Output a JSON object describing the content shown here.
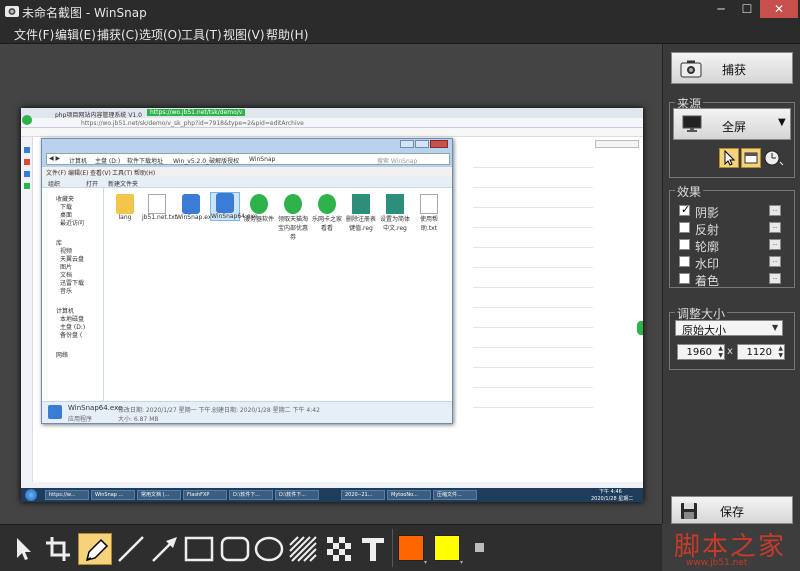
{
  "window": {
    "title": "未命名截图 - WinSnap"
  },
  "menu": [
    "文件(F)",
    "编辑(E)",
    "捕获(C)",
    "选项(O)",
    "工具(T)",
    "视图(V)",
    "帮助(H)"
  ],
  "panel": {
    "capture_label": "捕获",
    "source_label": "来源",
    "source_mode": "全屏",
    "effects_label": "效果",
    "effects": [
      {
        "label": "阴影",
        "checked": true
      },
      {
        "label": "反射",
        "checked": false
      },
      {
        "label": "轮廓",
        "checked": false
      },
      {
        "label": "水印",
        "checked": false
      },
      {
        "label": "着色",
        "checked": false
      }
    ],
    "resize_label": "调整大小",
    "resize_mode": "原始大小",
    "width": "1960",
    "height": "1120",
    "times": "x",
    "save_label": "保存"
  },
  "toolbar": {
    "tools": [
      "pointer",
      "crop",
      "pen",
      "line",
      "arrow",
      "rectangle",
      "rounded-rectangle",
      "ellipse",
      "hatch",
      "pixelate",
      "text"
    ],
    "color_primary": "#ff6600",
    "color_secondary": "#ffff00"
  },
  "watermark": {
    "text": "脚本之家",
    "url": "www.jb51.net"
  },
  "screenshot": {
    "browser_tabs": [
      "php项目网站内容管理系统 V1.0",
      "https://wo.jb51.net/tsk/demo/v"
    ],
    "browser_address": "https://wo.jb51.net/sk/demo/v_sk_php?id=7918&type=2&pid=editArchive",
    "explorer": {
      "path": [
        "计算机",
        "主盘 (D:)",
        "软件下载地址",
        "Win_v5.2.0_破解版授权",
        "WinSnap"
      ],
      "search_placeholder": "搜索 WinSnap",
      "menu": [
        "文件(F)",
        "编辑(E)",
        "查看(V)",
        "工具(T)",
        "帮助(H)"
      ],
      "commands": [
        "组织",
        "打开",
        "新建文件夹"
      ],
      "nav": [
        "收藏夹",
        "下载",
        "桌面",
        "最近访问",
        "库",
        "视频",
        "天翼云盘",
        "图片",
        "文档",
        "迅雷下载",
        "音乐",
        "计算机",
        "本地磁盘",
        "主盘 (D:)",
        "备份盘 (",
        "网络"
      ],
      "files": [
        {
          "name": "lang",
          "type": "folder"
        },
        {
          "name": "jb51.net.txt",
          "type": "txt"
        },
        {
          "name": "WinSnap.exe",
          "type": "exe"
        },
        {
          "name": "WinSnap64.exe",
          "type": "exe"
        },
        {
          "name": "服务器软件",
          "type": "app"
        },
        {
          "name": "领取天猫淘宝内部优惠券",
          "type": "app"
        },
        {
          "name": "乐网卡之家看看",
          "type": "app"
        },
        {
          "name": "删除注册表键值.reg",
          "type": "reg"
        },
        {
          "name": "设置为简体中文.reg",
          "type": "reg"
        },
        {
          "name": "使用帮助.txt",
          "type": "txt"
        }
      ],
      "status_file": "WinSnap64.exe",
      "status_modified": "修改日期: 2020/1/27 星期一 下午...",
      "status_created": "创建日期: 2020/1/28 星期二 下午 4:42",
      "status_type": "应用程序",
      "status_size": "大小: 6.87 MB"
    },
    "taskbar": [
      "https://w...",
      "WinSnap ...",
      "常用文档 (...",
      "FlashFXP",
      "D:\\软件下...",
      "D:\\软件下...",
      "2020--21...",
      "MytooNo...",
      "压缩文件..."
    ],
    "clock_time": "下午 4:46",
    "clock_date": "2020/1/28 星期二"
  }
}
